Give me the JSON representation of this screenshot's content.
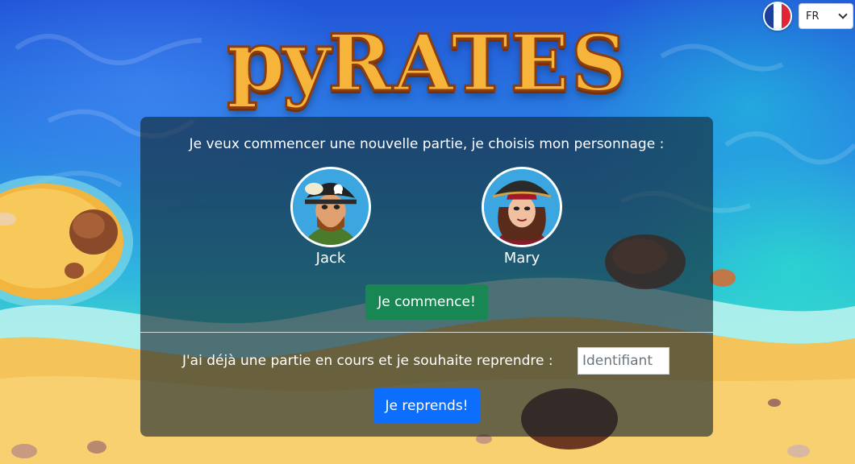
{
  "app": {
    "logo_text_lower": "py",
    "logo_text_upper": "RATES"
  },
  "language": {
    "flag_icon": "french-flag-icon",
    "selected": "FR",
    "flag_colors": [
      "#1d3f9c",
      "#ffffff",
      "#e02636"
    ]
  },
  "new_game": {
    "intro": "Je veux commencer une nouvelle partie, je choisis mon personnage :",
    "characters": [
      {
        "name": "Jack",
        "icon": "pirate-jack-avatar"
      },
      {
        "name": "Mary",
        "icon": "pirate-mary-avatar"
      }
    ],
    "start_label": "Je commence!"
  },
  "resume": {
    "label": "J'ai déjà une partie en cours et je souhaite reprendre :",
    "placeholder": "Identifiant",
    "value": "",
    "resume_label": "Je reprends!"
  },
  "colors": {
    "start_button": "#198754",
    "resume_button": "#0d6efd",
    "logo": "#f6b43a"
  }
}
